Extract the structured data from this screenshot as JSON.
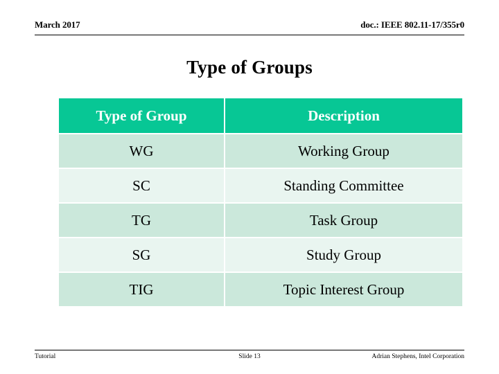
{
  "header": {
    "left": "March 2017",
    "right": "doc.: IEEE 802.11-17/355r0"
  },
  "title": "Type of Groups",
  "table": {
    "columns": [
      "Type of Group",
      "Description"
    ],
    "rows": [
      {
        "abbr": "WG",
        "description": "Working Group"
      },
      {
        "abbr": "SC",
        "description": "Standing Committee"
      },
      {
        "abbr": "TG",
        "description": "Task Group"
      },
      {
        "abbr": "SG",
        "description": "Study Group"
      },
      {
        "abbr": "TIG",
        "description": "Topic Interest Group"
      }
    ],
    "colors": {
      "header_background": "#07C795",
      "header_text": "#FFFFFF",
      "row_band_dark": "#CBE8DB",
      "row_band_light": "#E9F5F0",
      "cell_text": "#000000"
    }
  },
  "footer": {
    "left": "Tutorial",
    "center": "Slide 13",
    "right": "Adrian Stephens, Intel Corporation"
  }
}
